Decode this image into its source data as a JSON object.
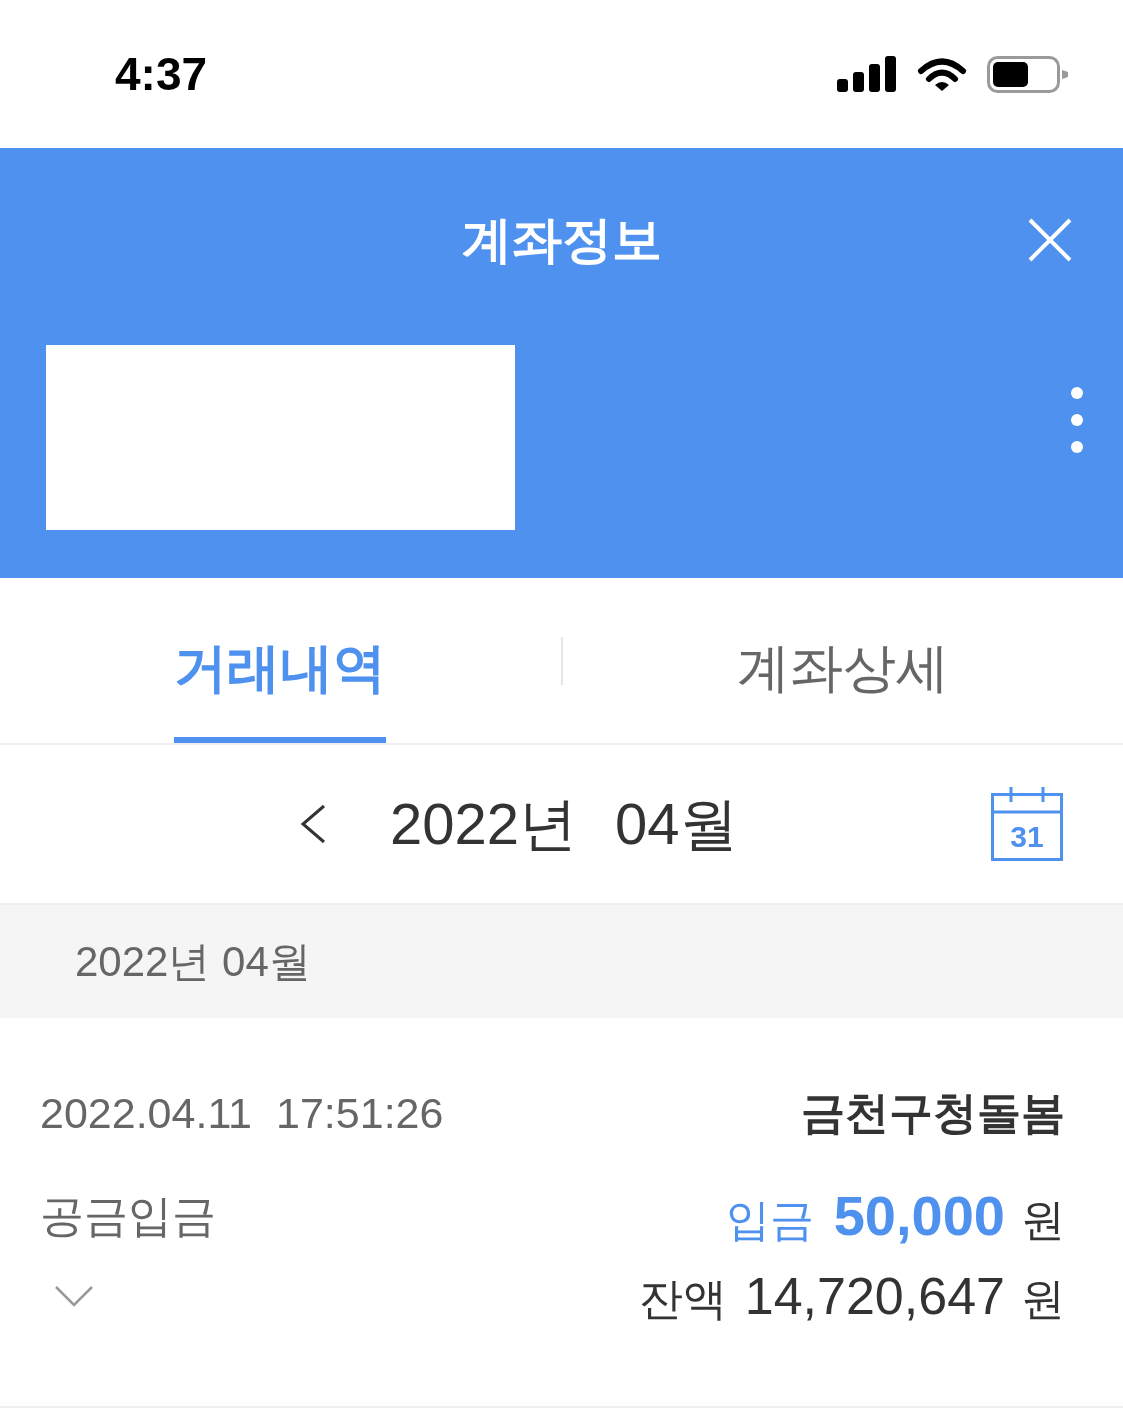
{
  "status_bar": {
    "time": "4:37"
  },
  "header": {
    "title": "계좌정보"
  },
  "tabs": [
    {
      "label": "거래내역",
      "selected": true
    },
    {
      "label": "계좌상세",
      "selected": false
    }
  ],
  "month_nav": {
    "year": "2022년",
    "month": "04월",
    "calendar_day": "31"
  },
  "sections": [
    {
      "heading": "2022년 04월",
      "transactions": [
        {
          "date": "2022.04.11",
          "time": "17:51:26",
          "counterparty": "금천구청돌봄",
          "description": "공금입금",
          "type_label": "입금",
          "amount": "50,000",
          "amount_unit": "원",
          "balance_label": "잔액",
          "balance": "14,720,647",
          "balance_unit": "원",
          "expanded": false
        }
      ]
    }
  ]
}
